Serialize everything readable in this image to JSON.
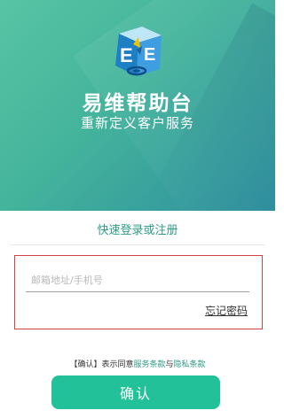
{
  "brand": {
    "app_name": "易维帮助台",
    "slogan": "重新定义客户服务",
    "logo_icon": "easyops-cube-logo-icon"
  },
  "login": {
    "quick_login_link": "快速登录或注册",
    "account_placeholder": "邮箱地址/手机号",
    "account_value": "",
    "forgot_password": "忘记密码"
  },
  "terms": {
    "prefix": "【确认】表示同意",
    "service_terms": "服务条款",
    "connector": "与",
    "privacy_terms": "隐私条款"
  },
  "actions": {
    "confirm_label": "确认"
  },
  "colors": {
    "hero_start": "#57c5a4",
    "hero_end": "#2f8fa0",
    "accent_link": "#2e9b86",
    "button": "#22c19a",
    "highlight_border": "#d94040"
  }
}
